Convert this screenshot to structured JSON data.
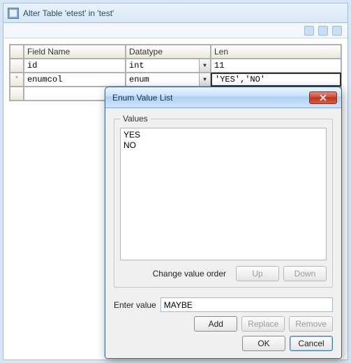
{
  "window": {
    "title": "Alter Table 'etest' in 'test'"
  },
  "grid": {
    "headers": {
      "field": "Field Name",
      "datatype": "Datatype",
      "len": "Len"
    },
    "rows": [
      {
        "marker": "",
        "field": "id",
        "datatype": "int",
        "len": "11"
      },
      {
        "marker": "*",
        "field": "enumcol",
        "datatype": "enum",
        "len": "'YES','NO'"
      },
      {
        "marker": "",
        "field": "",
        "datatype": "",
        "len": ""
      }
    ]
  },
  "dialog": {
    "title": "Enum Value List",
    "values_legend": "Values",
    "values": [
      "YES",
      "NO"
    ],
    "change_order_label": "Change value order",
    "up_label": "Up",
    "down_label": "Down",
    "enter_label": "Enter value",
    "enter_value": "MAYBE",
    "add_label": "Add",
    "replace_label": "Replace",
    "remove_label": "Remove",
    "ok_label": "OK",
    "cancel_label": "Cancel"
  }
}
